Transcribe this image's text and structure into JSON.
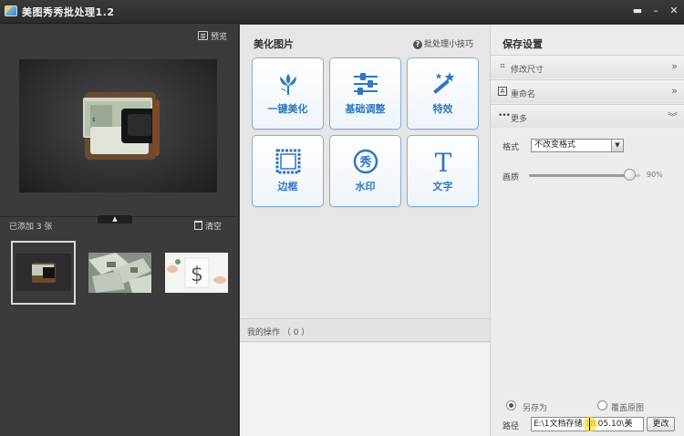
{
  "window": {
    "title": "美图秀秀批处理1.2",
    "controls": {
      "menu": "▬",
      "minimize": "–",
      "close": "✕"
    }
  },
  "left_panel": {
    "preview_label": "预览",
    "added_text": "已添加 3 张",
    "clear_label": "清空",
    "collapse_glyph": "▲"
  },
  "middle_panel": {
    "title": "美化图片",
    "tips_label": "批处理小技巧",
    "tools": [
      {
        "label": "一键美化",
        "icon": "tulip-icon"
      },
      {
        "label": "基础调整",
        "icon": "sliders-icon"
      },
      {
        "label": "特效",
        "icon": "magic-wand-icon"
      },
      {
        "label": "边框",
        "icon": "frame-icon"
      },
      {
        "label": "水印",
        "icon": "watermark-icon"
      },
      {
        "label": "文字",
        "icon": "text-icon"
      }
    ],
    "watermark_glyph": "秀",
    "text_glyph": "T",
    "ops_label": "我的操作 （ 0 ）"
  },
  "right_panel": {
    "title": "保存设置",
    "rows": [
      {
        "label": "修改尺寸",
        "icon": "crop-icon",
        "chevron": "»"
      },
      {
        "label": "重命名",
        "icon": "rename-icon",
        "chevron": "»"
      },
      {
        "label": "更多",
        "icon": "more-icon",
        "chevron": "︾"
      }
    ],
    "format_label": "格式",
    "format_value": "不改变格式",
    "quality_label": "画质",
    "quality_value": "90%",
    "quality_fraction": 0.9,
    "save_as_label": "另存为",
    "overwrite_label": "覆盖原图",
    "path_label": "路径",
    "path_value": "E:\\1文档存储 18.05.10\\美",
    "change_label": "更改"
  },
  "colors": {
    "accent": "#2f78c0",
    "tool_border": "#7fb1dd",
    "dark_bg": "#3b3b3b"
  }
}
